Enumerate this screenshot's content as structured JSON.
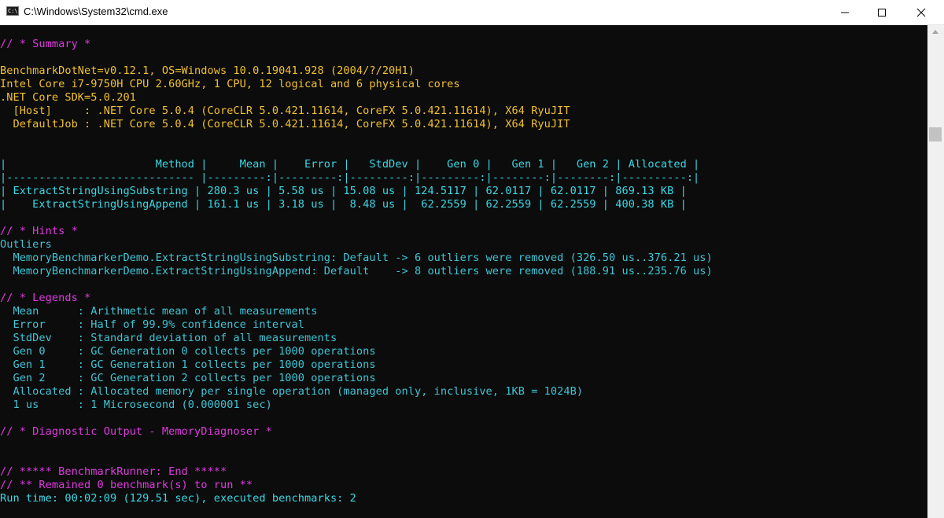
{
  "window": {
    "title": "C:\\Windows\\System32\\cmd.exe",
    "icon_label": "C:\\"
  },
  "console": {
    "lines": [
      {
        "text": "// * Summary *",
        "color": "magenta"
      },
      {
        "text": "",
        "color": "yellow"
      },
      {
        "text": "BenchmarkDotNet=v0.12.1, OS=Windows 10.0.19041.928 (2004/?/20H1)",
        "color": "yellow"
      },
      {
        "text": "Intel Core i7-9750H CPU 2.60GHz, 1 CPU, 12 logical and 6 physical cores",
        "color": "yellow"
      },
      {
        "text": ".NET Core SDK=5.0.201",
        "color": "yellow"
      },
      {
        "text": "  [Host]     : .NET Core 5.0.4 (CoreCLR 5.0.421.11614, CoreFX 5.0.421.11614), X64 RyuJIT",
        "color": "yellow"
      },
      {
        "text": "  DefaultJob : .NET Core 5.0.4 (CoreCLR 5.0.421.11614, CoreFX 5.0.421.11614), X64 RyuJIT",
        "color": "yellow"
      },
      {
        "text": "",
        "color": "cyan"
      },
      {
        "text": "",
        "color": "cyan"
      },
      {
        "text": "|                       Method |     Mean |    Error |   StdDev |    Gen 0 |   Gen 1 |   Gen 2 | Allocated |",
        "color": "cyan"
      },
      {
        "text": "|----------------------------- |---------:|---------:|---------:|---------:|--------:|--------:|----------:|",
        "color": "cyan"
      },
      {
        "text": "| ExtractStringUsingSubstring | 280.3 us | 5.58 us | 15.08 us | 124.5117 | 62.0117 | 62.0117 | 869.13 KB |",
        "color": "cyan"
      },
      {
        "text": "|    ExtractStringUsingAppend | 161.1 us | 3.18 us |  8.48 us |  62.2559 | 62.2559 | 62.2559 | 400.38 KB |",
        "color": "cyan"
      },
      {
        "text": "",
        "color": "cyan"
      },
      {
        "text": "// * Hints *",
        "color": "magenta"
      },
      {
        "text": "Outliers",
        "color": "teal"
      },
      {
        "text": "  MemoryBenchmarkerDemo.ExtractStringUsingSubstring: Default -> 6 outliers were removed (326.50 us..376.21 us)",
        "color": "teal"
      },
      {
        "text": "  MemoryBenchmarkerDemo.ExtractStringUsingAppend: Default    -> 8 outliers were removed (188.91 us..235.76 us)",
        "color": "teal"
      },
      {
        "text": "",
        "color": "teal"
      },
      {
        "text": "// * Legends *",
        "color": "magenta"
      },
      {
        "text": "  Mean      : Arithmetic mean of all measurements",
        "color": "teal"
      },
      {
        "text": "  Error     : Half of 99.9% confidence interval",
        "color": "teal"
      },
      {
        "text": "  StdDev    : Standard deviation of all measurements",
        "color": "teal"
      },
      {
        "text": "  Gen 0     : GC Generation 0 collects per 1000 operations",
        "color": "teal"
      },
      {
        "text": "  Gen 1     : GC Generation 1 collects per 1000 operations",
        "color": "teal"
      },
      {
        "text": "  Gen 2     : GC Generation 2 collects per 1000 operations",
        "color": "teal"
      },
      {
        "text": "  Allocated : Allocated memory per single operation (managed only, inclusive, 1KB = 1024B)",
        "color": "teal"
      },
      {
        "text": "  1 us      : 1 Microsecond (0.000001 sec)",
        "color": "teal"
      },
      {
        "text": "",
        "color": "teal"
      },
      {
        "text": "// * Diagnostic Output - MemoryDiagnoser *",
        "color": "magenta"
      },
      {
        "text": "",
        "color": "teal"
      },
      {
        "text": "",
        "color": "teal"
      },
      {
        "text": "// ***** BenchmarkRunner: End *****",
        "color": "magenta"
      },
      {
        "text": "// ** Remained 0 benchmark(s) to run **",
        "color": "magenta"
      },
      {
        "text": "Run time: 00:02:09 (129.51 sec), executed benchmarks: 2",
        "color": "cyan"
      }
    ]
  },
  "colors": {
    "background": "#0c0c0c",
    "magenta": "#e03ae0",
    "yellow": "#f2c12e",
    "cyan": "#3ad8e6",
    "teal": "#3fc5d6"
  },
  "icons": {
    "app": "console-app-icon",
    "minimize": "minimize-icon",
    "maximize": "maximize-icon",
    "close": "close-icon"
  }
}
